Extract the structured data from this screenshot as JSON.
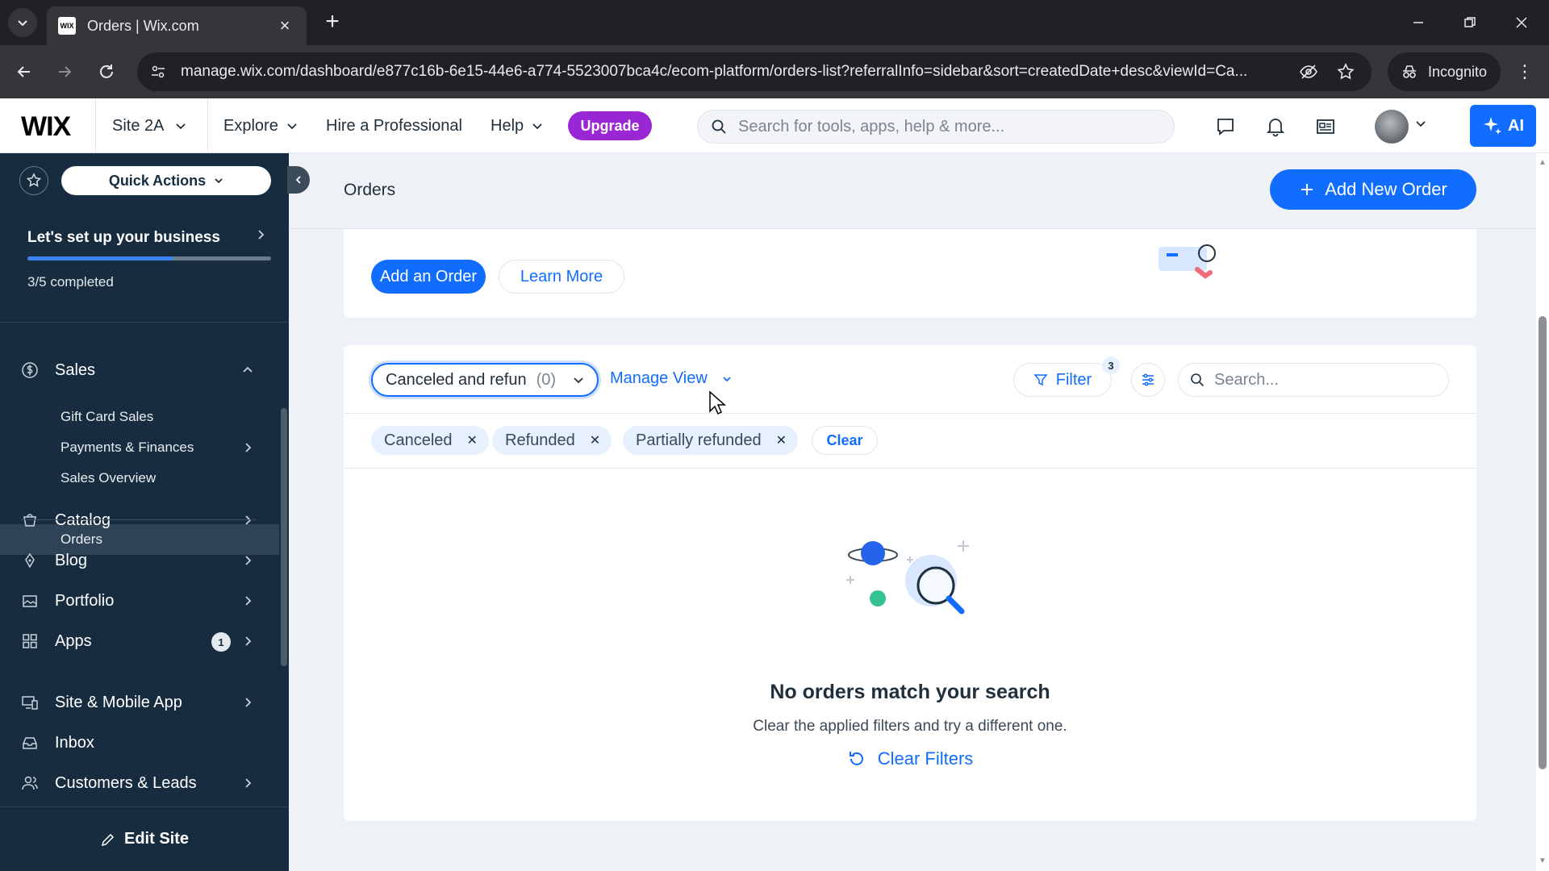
{
  "browser": {
    "tab_title": "Orders | Wix.com",
    "favicon_text": "WIX",
    "url": "manage.wix.com/dashboard/e877c16b-6e15-44e6-a774-5523007bca4c/ecom-platform/orders-list?referralInfo=sidebar&sort=createdDate+desc&viewId=Ca...",
    "incognito_label": "Incognito"
  },
  "topbar": {
    "logo": "WIX",
    "site_name": "Site 2A",
    "nav": {
      "explore": "Explore",
      "hire": "Hire a Professional",
      "help": "Help"
    },
    "upgrade_label": "Upgrade",
    "search_placeholder": "Search for tools, apps, help & more...",
    "ai_label": "AI"
  },
  "sidebar": {
    "quick_actions": "Quick Actions",
    "setup": {
      "title": "Let's set up your business",
      "progress": 0.6,
      "count": "3/5 completed"
    },
    "sales": {
      "label": "Sales",
      "items": [
        {
          "label": "Orders"
        },
        {
          "label": "Gift Card Sales"
        },
        {
          "label": "Payments & Finances"
        },
        {
          "label": "Sales Overview"
        }
      ]
    },
    "items": [
      {
        "label": "Catalog"
      },
      {
        "label": "Blog"
      },
      {
        "label": "Portfolio"
      },
      {
        "label": "Apps",
        "badge": "1"
      },
      {
        "label": "Site & Mobile App"
      },
      {
        "label": "Inbox"
      },
      {
        "label": "Customers & Leads"
      }
    ],
    "edit_site": "Edit Site"
  },
  "main": {
    "page_title": "Orders",
    "add_new_order": "Add New Order",
    "banner": {
      "add_order": "Add an Order",
      "learn_more": "Learn More"
    },
    "view_select": {
      "label": "Canceled and refun",
      "count": "(0)"
    },
    "manage_view": "Manage View",
    "filter": {
      "label": "Filter",
      "count": "3"
    },
    "search_placeholder": "Search...",
    "chips": [
      "Canceled",
      "Refunded",
      "Partially refunded"
    ],
    "clear_label": "Clear",
    "empty": {
      "title": "No orders match your search",
      "subtitle": "Clear the applied filters and try a different one.",
      "action": "Clear Filters"
    }
  },
  "colors": {
    "accent": "#116dff",
    "upgrade": "#9a27d5",
    "sidebar_bg": "#172d3f"
  }
}
